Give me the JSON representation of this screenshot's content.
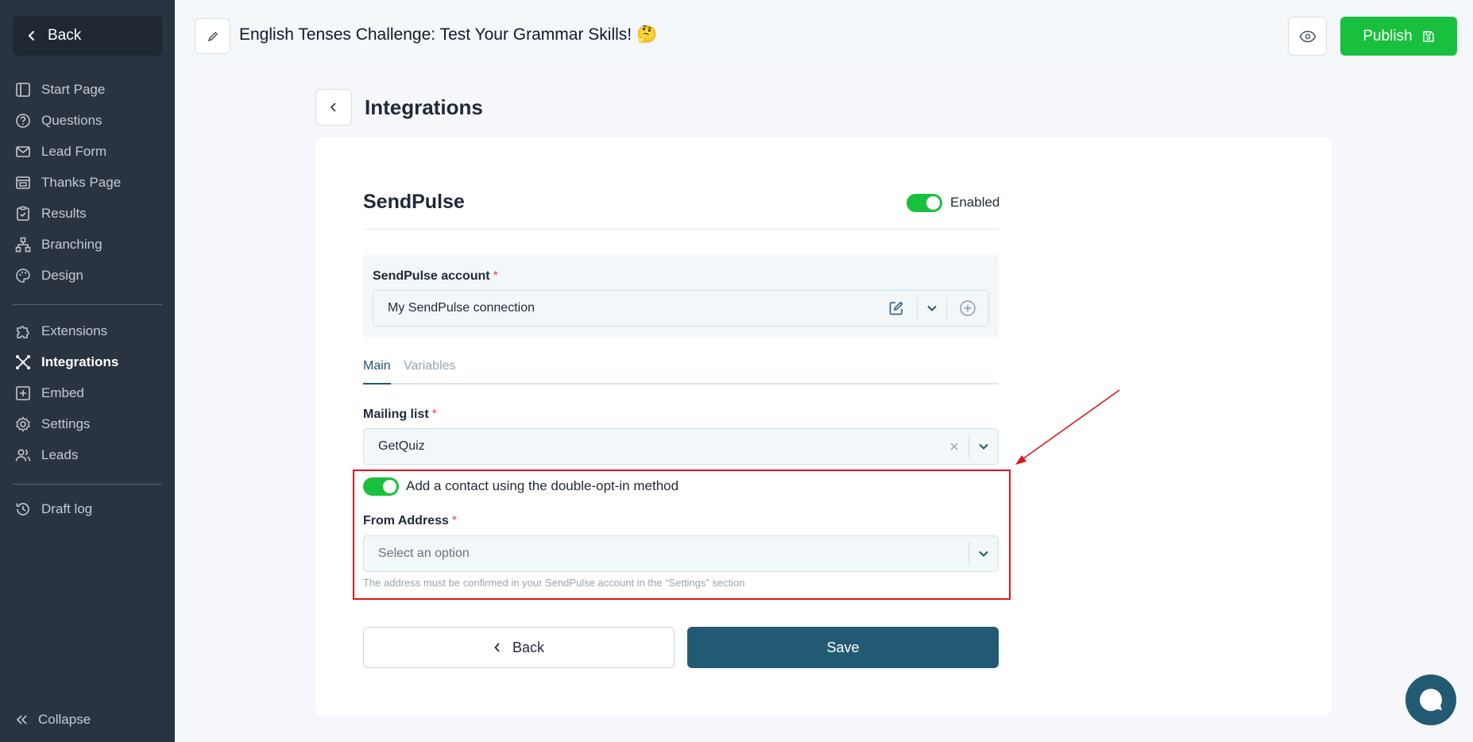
{
  "sidebar": {
    "back_label": "Back",
    "items": [
      {
        "label": "Start Page",
        "icon": "layout-icon"
      },
      {
        "label": "Questions",
        "icon": "question-icon"
      },
      {
        "label": "Lead Form",
        "icon": "mail-icon"
      },
      {
        "label": "Thanks Page",
        "icon": "page-icon"
      },
      {
        "label": "Results",
        "icon": "clipboard-icon"
      },
      {
        "label": "Branching",
        "icon": "branch-icon"
      },
      {
        "label": "Design",
        "icon": "palette-icon"
      },
      {
        "label": "Extensions",
        "icon": "puzzle-icon"
      },
      {
        "label": "Integrations",
        "icon": "integration-icon",
        "active": true
      },
      {
        "label": "Embed",
        "icon": "embed-icon"
      },
      {
        "label": "Settings",
        "icon": "gear-icon"
      },
      {
        "label": "Leads",
        "icon": "users-icon"
      },
      {
        "label": "Draft log",
        "icon": "history-icon"
      }
    ],
    "collapse_label": "Collapse"
  },
  "topbar": {
    "quiz_title": "English Tenses Challenge: Test Your Grammar Skills! 🤔",
    "publish_label": "Publish"
  },
  "page": {
    "title": "Integrations"
  },
  "integration": {
    "name": "SendPulse",
    "enabled_label": "Enabled",
    "enabled": true,
    "account_label": "SendPulse account",
    "account_value": "My SendPulse connection",
    "tabs": [
      "Main",
      "Variables"
    ],
    "mailing_list_label": "Mailing list",
    "mailing_list_value": "GetQuiz",
    "double_opt_in_label": "Add a contact using the double-opt-in method",
    "double_opt_in": true,
    "from_address_label": "From Address",
    "from_address_placeholder": "Select an option",
    "from_address_hint": "The address must be confirmed in your SendPulse account in the “Settings” section",
    "required_mark": "*"
  },
  "actions": {
    "back_label": "Back",
    "save_label": "Save"
  },
  "colors": {
    "sidebar_bg": "#2a3340",
    "accent_green": "#19c03e",
    "primary": "#235a73",
    "highlight_red": "#e0141e"
  }
}
